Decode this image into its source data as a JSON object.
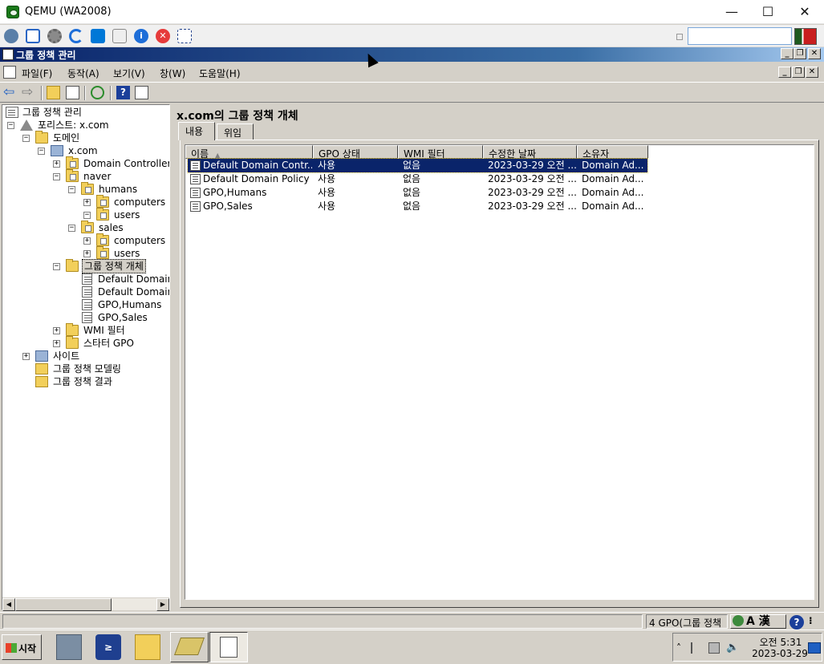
{
  "host": {
    "title": "QEMU (WA2008)",
    "controls": {
      "minimize": "—",
      "maximize": "☐",
      "close": "✕"
    },
    "toolbar_icons": [
      "network-icon",
      "fullscreen-icon",
      "settings-icon",
      "refresh-icon",
      "windows-icon",
      "drive-icon",
      "info-icon",
      "stop-icon",
      "screenshot-icon"
    ]
  },
  "mmc": {
    "title": "그룹 정책 관리",
    "menu": [
      "파일(F)",
      "동작(A)",
      "보기(V)",
      "창(W)",
      "도움말(H)"
    ]
  },
  "tree": {
    "root": "그룹 정책 관리",
    "forest": "포리스트: x.com",
    "domains": "도메인",
    "domain": "x.com",
    "domain_controllers": "Domain Controllers",
    "naver": "naver",
    "humans": "humans",
    "humans_computers": "computers",
    "humans_users": "users",
    "sales": "sales",
    "sales_computers": "computers",
    "sales_users": "users",
    "gpo_objects": "그룹 정책 개체",
    "gpo1": "Default Domain",
    "gpo2": "Default Domain",
    "gpo3": "GPO,Humans",
    "gpo4": "GPO,Sales",
    "wmi": "WMI 필터",
    "starter": "스타터 GPO",
    "sites": "사이트",
    "modeling": "그룹 정책 모델링",
    "results": "그룹 정책 결과"
  },
  "right": {
    "title": "x.com의 그룹 정책 개체",
    "tabs": [
      "내용",
      "위임"
    ],
    "columns": [
      "이름",
      "GPO 상태",
      "WMI 필터",
      "수정한 날짜",
      "소유자"
    ],
    "rows": [
      {
        "name": "Default Domain Contr...",
        "status": "사용",
        "wmi": "없음",
        "date": "2023-03-29 오전 ...",
        "owner": "Domain Ad..."
      },
      {
        "name": "Default Domain Policy",
        "status": "사용",
        "wmi": "없음",
        "date": "2023-03-29 오전 ...",
        "owner": "Domain Ad..."
      },
      {
        "name": "GPO,Humans",
        "status": "사용",
        "wmi": "없음",
        "date": "2023-03-29 오전 ...",
        "owner": "Domain Ad..."
      },
      {
        "name": "GPO,Sales",
        "status": "사용",
        "wmi": "없음",
        "date": "2023-03-29 오전 ...",
        "owner": "Domain Ad..."
      }
    ]
  },
  "status": {
    "count": "4 GPO(그룹 정책",
    "ime": "A 漢",
    "ime_help": "?"
  },
  "taskbar": {
    "start": "시작",
    "time": "오전 5:31",
    "date": "2023-03-29"
  }
}
